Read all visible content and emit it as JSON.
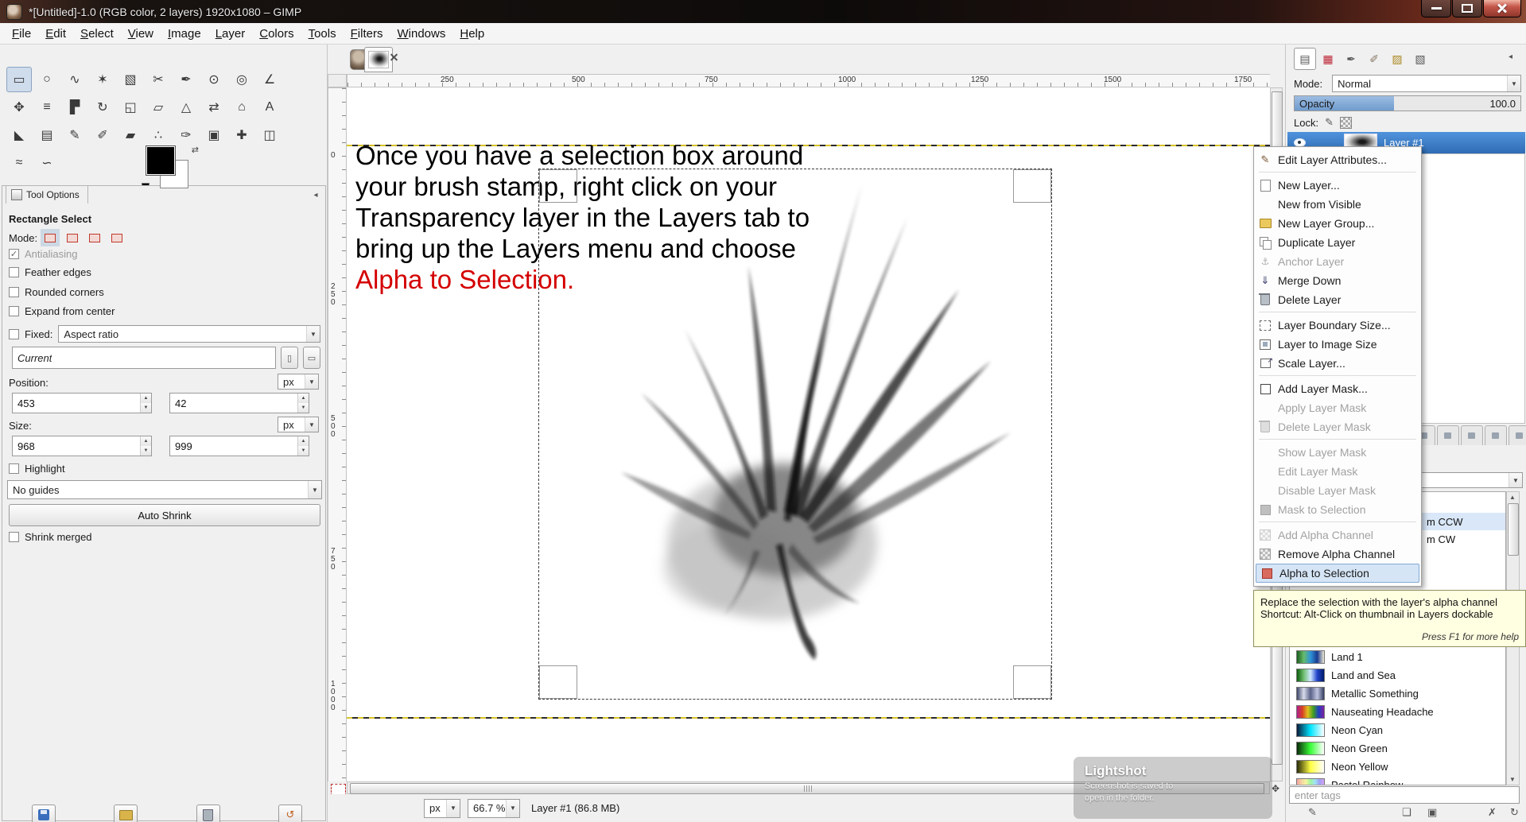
{
  "colors": {
    "selection_blue": "#2f6cb5",
    "canvas_red": "#d40000",
    "boundary_yellow": "#d8c32a",
    "tooltip_bg": "#ffffe1"
  },
  "window": {
    "title": "*[Untitled]-1.0 (RGB color, 2 layers) 1920x1080 – GIMP"
  },
  "menubar": {
    "items": [
      "File",
      "Edit",
      "Select",
      "View",
      "Image",
      "Layer",
      "Colors",
      "Tools",
      "Filters",
      "Windows",
      "Help"
    ]
  },
  "toolbox": {
    "tools": [
      {
        "name": "tool-rectangle-select",
        "glyph": "▭"
      },
      {
        "name": "tool-ellipse-select",
        "glyph": "○"
      },
      {
        "name": "tool-free-select",
        "glyph": "∿"
      },
      {
        "name": "tool-fuzzy-select",
        "glyph": "✶"
      },
      {
        "name": "tool-select-by-color",
        "glyph": "▧"
      },
      {
        "name": "tool-scissors-select",
        "glyph": "✂"
      },
      {
        "name": "tool-paths",
        "glyph": "✒"
      },
      {
        "name": "tool-color-picker",
        "glyph": "⊙"
      },
      {
        "name": "tool-zoom",
        "glyph": "◎"
      },
      {
        "name": "tool-measure",
        "glyph": "∠"
      },
      {
        "name": "tool-move",
        "glyph": "✥"
      },
      {
        "name": "tool-align",
        "glyph": "≡"
      },
      {
        "name": "tool-crop",
        "glyph": "▛"
      },
      {
        "name": "tool-rotate",
        "glyph": "↻"
      },
      {
        "name": "tool-scale",
        "glyph": "◱"
      },
      {
        "name": "tool-shear",
        "glyph": "▱"
      },
      {
        "name": "tool-perspective",
        "glyph": "△"
      },
      {
        "name": "tool-flip",
        "glyph": "⇄"
      },
      {
        "name": "tool-cage-transform",
        "glyph": "⌂"
      },
      {
        "name": "tool-text",
        "glyph": "A"
      },
      {
        "name": "tool-bucket-fill",
        "glyph": "◣"
      },
      {
        "name": "tool-blend",
        "glyph": "▤"
      },
      {
        "name": "tool-pencil",
        "glyph": "✎"
      },
      {
        "name": "tool-paintbrush",
        "glyph": "✐"
      },
      {
        "name": "tool-eraser",
        "glyph": "▰"
      },
      {
        "name": "tool-airbrush",
        "glyph": "∴"
      },
      {
        "name": "tool-ink",
        "glyph": "✑"
      },
      {
        "name": "tool-clone",
        "glyph": "▣"
      },
      {
        "name": "tool-heal",
        "glyph": "✚"
      },
      {
        "name": "tool-perspective-clone",
        "glyph": "◫"
      },
      {
        "name": "tool-blur-sharpen",
        "glyph": "≈"
      },
      {
        "name": "tool-smudge",
        "glyph": "∽"
      }
    ]
  },
  "tool_options": {
    "panel_title": "Tool Options",
    "tool_name": "Rectangle Select",
    "mode_label": "Mode:",
    "checkboxes": [
      {
        "label": "Antialiasing",
        "checked": true,
        "enabled": false
      },
      {
        "label": "Feather edges",
        "checked": false,
        "enabled": true
      },
      {
        "label": "Rounded corners",
        "checked": false,
        "enabled": true
      },
      {
        "label": "Expand from center",
        "checked": false,
        "enabled": true
      }
    ],
    "fixed_label": "Fixed:",
    "fixed_value": "Aspect ratio",
    "ratio_value": "Current",
    "position_label": "Position:",
    "position_x": "453",
    "position_y": "42",
    "size_label": "Size:",
    "size_w": "968",
    "size_h": "999",
    "unit": "px",
    "highlight_label": "Highlight",
    "guides_value": "No guides",
    "auto_shrink_label": "Auto Shrink",
    "shrink_merged_label": "Shrink merged"
  },
  "canvas": {
    "ruler_h": [
      "250",
      "500",
      "750",
      "1000",
      "1250",
      "1500",
      "1750"
    ],
    "ruler_v": [
      "0",
      "250",
      "500",
      "750",
      "1000"
    ],
    "text_before": "Once you have a selection box around your brush stamp, right click on your Transparency layer in the Layers tab to bring up the Layers menu and choose ",
    "text_red": "Alpha to Selection.",
    "statusbar": {
      "unit": "px",
      "zoom": "66.7 %",
      "status": "Layer #1 (86.8 MB)"
    }
  },
  "layers_panel": {
    "mode_label": "Mode:",
    "mode_value": "Normal",
    "opacity_label": "Opacity",
    "opacity_value": "100.0",
    "lock_label": "Lock:",
    "layer_name": "Layer #1"
  },
  "dock2": {
    "fragments": [
      "m CCW",
      "m CW"
    ],
    "gradients": [
      {
        "name": "Land 1",
        "css": "linear-gradient(90deg,#1b5e20,#66bb6a,#2e94d8,#1a3a8f,#efe9d2)"
      },
      {
        "name": "Land and Sea",
        "css": "linear-gradient(90deg,#0b5e0b,#6fbf6f,#cfe8ff,#2244cc,#001a66)"
      },
      {
        "name": "Metallic Something",
        "css": "linear-gradient(90deg,#3e4668,#d8dcec,#5a6288,#c0c6e0,#343c60)"
      },
      {
        "name": "Nauseating Headache",
        "css": "linear-gradient(90deg,#b02090,#d84020,#e0c020,#40a020,#2040c0,#8020a0)"
      },
      {
        "name": "Neon Cyan",
        "css": "linear-gradient(90deg,#0a1a3a,#00e5ff,#ffffff)"
      },
      {
        "name": "Neon Green",
        "css": "linear-gradient(90deg,#0a2a0a,#39ff39,#ffffff)"
      },
      {
        "name": "Neon Yellow",
        "css": "linear-gradient(90deg,#2a2a0a,#ffff44,#ffffff)"
      },
      {
        "name": "Pastel Rainbow",
        "css": "linear-gradient(90deg,#f4a0a0,#f4d4a0,#f4f4a0,#a0f4a0,#a0e4f4,#a0a0f4,#d4a0f4)"
      }
    ],
    "tags_placeholder": "enter tags"
  },
  "context_menu": {
    "items": [
      {
        "label": "Edit Layer Attributes...",
        "icon": "edit"
      },
      {
        "label": "New Layer...",
        "icon": "page"
      },
      {
        "label": "New from Visible",
        "icon": "none"
      },
      {
        "label": "New Layer Group...",
        "icon": "folder"
      },
      {
        "label": "Duplicate Layer",
        "icon": "duplicate"
      },
      {
        "label": "Anchor Layer",
        "icon": "anchor",
        "disabled": true
      },
      {
        "label": "Merge Down",
        "icon": "merge"
      },
      {
        "label": "Delete Layer",
        "icon": "trash"
      },
      {
        "label": "Layer Boundary Size...",
        "icon": "boundary"
      },
      {
        "label": "Layer to Image Size",
        "icon": "fit-image"
      },
      {
        "label": "Scale Layer...",
        "icon": "scale"
      },
      {
        "label": "Add Layer Mask...",
        "icon": "mask"
      },
      {
        "label": "Apply Layer Mask",
        "icon": "none",
        "disabled": true
      },
      {
        "label": "Delete Layer Mask",
        "icon": "trash",
        "disabled": true
      },
      {
        "label": "Show Layer Mask",
        "icon": "none",
        "disabled": true
      },
      {
        "label": "Edit Layer Mask",
        "icon": "none",
        "disabled": true
      },
      {
        "label": "Disable Layer Mask",
        "icon": "none",
        "disabled": true
      },
      {
        "label": "Mask to Selection",
        "icon": "selection",
        "disabled": true
      },
      {
        "label": "Add Alpha Channel",
        "icon": "checker",
        "disabled": true
      },
      {
        "label": "Remove Alpha Channel",
        "icon": "checker"
      },
      {
        "label": "Alpha to Selection",
        "icon": "selection",
        "selected": true
      }
    ]
  },
  "tooltip": {
    "line1": "Replace the selection with the layer's alpha channel",
    "line2": "Shortcut: Alt-Click on thumbnail in Layers dockable",
    "hint": "Press F1 for more help"
  },
  "lightshot": {
    "title": "Lightshot",
    "line1": "Screenshot is saved to",
    "line2": "open in the folder."
  }
}
